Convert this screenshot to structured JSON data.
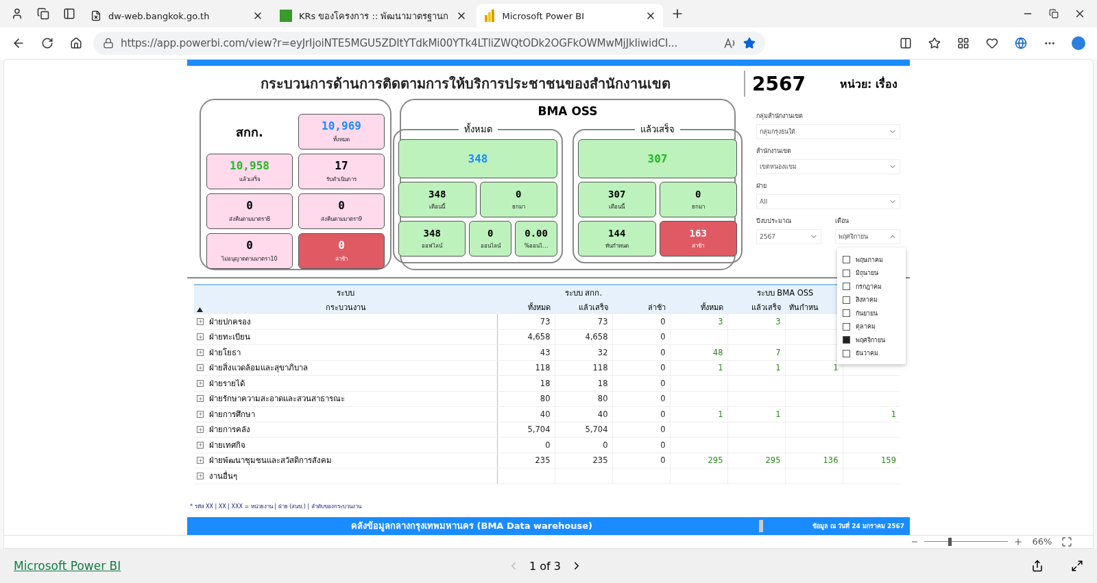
{
  "browser": {
    "tabs": [
      {
        "title": "dw-web.bangkok.go.th",
        "selected": false,
        "kind": "page"
      },
      {
        "title": "KRs ของโครงการ :: พัฒนามาตรฐานก",
        "selected": false,
        "kind": "logo"
      },
      {
        "title": "Microsoft Power BI",
        "selected": true,
        "kind": "powerbi"
      }
    ],
    "url": "https://app.powerbi.com/view?r=eyJrIjoiNTE5MGU5ZDItYTdkMi00YTk4LTliZWQtODk2OGFkOWMwMjJkIiwidCI...",
    "favorite": true
  },
  "report": {
    "title": "กระบวนการด้านการติดตามการให้บริการประชาชนของสำนักงานเขต",
    "year": "2567",
    "unit": "หน่วย: เรื่อง",
    "skk": {
      "title": "สกก.",
      "cards": [
        {
          "value": "10,969",
          "label": "ทั้งหมด",
          "late": false,
          "color": "#1a8cff"
        },
        {
          "value": "10,958",
          "label": "แล้วเสร็จ",
          "late": false,
          "color": "#22bb22"
        },
        {
          "value": "17",
          "label": "รับดำเนินการ",
          "late": false,
          "color": "#000000"
        },
        {
          "value": "0",
          "label": "ส่งคืนตามมาตรา8",
          "late": false,
          "color": "#000000"
        },
        {
          "value": "0",
          "label": "ส่งคืนตามมาตรา9",
          "late": false,
          "color": "#000000"
        },
        {
          "value": "0",
          "label": "ไม่อนุญาตตามมาตรา10",
          "late": false,
          "color": "#000000"
        },
        {
          "value": "0",
          "label": "ล่าช้า",
          "late": true,
          "color": "#ffffff"
        }
      ]
    },
    "oss": {
      "title": "BMA OSS",
      "groups": [
        {
          "title": "ทั้งหมด",
          "main": {
            "value": "348",
            "late": false,
            "color": "#1a8cff"
          },
          "rows": [
            [
              {
                "value": "348",
                "label": "เดือนนี้",
                "late": false,
                "color": "#000000"
              },
              {
                "value": "0",
                "label": "ยกมา",
                "late": false,
                "color": "#000000"
              }
            ],
            [
              {
                "value": "348",
                "label": "ออฟไลน์",
                "late": false,
                "color": "#000000"
              },
              {
                "value": "0",
                "label": "ออนไลน์",
                "late": false,
                "color": "#000000"
              },
              {
                "value": "0.00",
                "label": "%ออนไ…",
                "late": false,
                "color": "#000000"
              }
            ]
          ]
        },
        {
          "title": "แล้วเสร็จ",
          "main": {
            "value": "307",
            "late": false,
            "color": "#22bb22"
          },
          "rows": [
            [
              {
                "value": "307",
                "label": "เดือนนี้",
                "late": false,
                "color": "#000000"
              },
              {
                "value": "0",
                "label": "ยกมา",
                "late": false,
                "color": "#000000"
              }
            ],
            [
              {
                "value": "144",
                "label": "ทันกำหนด",
                "late": false,
                "color": "#000000"
              },
              {
                "value": "163",
                "label": "ล่าช้า",
                "late": true,
                "color": "#ffffff"
              }
            ]
          ]
        }
      ]
    },
    "filters": [
      {
        "label": "กลุ่มสำนักงานเขต",
        "value": "กลุ่มกรุงธนใต้",
        "open": false
      },
      {
        "label": "สำนักงานเขต",
        "value": "เขตหนองแขม",
        "open": false
      },
      {
        "label": "ฝ่าย",
        "value": "All",
        "open": false
      },
      {
        "label": "ปีงบประมาณ",
        "value": "2567",
        "open": false
      },
      {
        "label": "เดือน",
        "value": "พฤศจิกายน",
        "open": true,
        "options": [
          {
            "label": "พฤษภาคม",
            "checked": false
          },
          {
            "label": "มิถุนายน",
            "checked": false
          },
          {
            "label": "กรกฎาคม",
            "checked": false
          },
          {
            "label": "สิงหาคม",
            "checked": false
          },
          {
            "label": "กันยายน",
            "checked": false
          },
          {
            "label": "ตุลาคม",
            "checked": false
          },
          {
            "label": "พฤศจิกายน",
            "checked": true
          },
          {
            "label": "ธันวาคม",
            "checked": false
          }
        ]
      }
    ],
    "table": {
      "groups": [
        {
          "label": "ระบบ",
          "columns": [
            "กระบวนงาน"
          ]
        },
        {
          "label": "ระบบ สกก.",
          "columns": [
            "ทั้งหมด",
            "แล้วเสร็จ",
            "ล่าช้า"
          ]
        },
        {
          "label": "ระบบ BMA OSS",
          "columns": [
            "ทั้งหมด",
            "แล้วเสร็จ",
            "ทันกำหน"
          ]
        }
      ],
      "rows": [
        {
          "name": "ฝ่ายปกครอง",
          "expanded": false,
          "cells": {
            "skk_total": "73",
            "skk_done": "73",
            "skk_late": "0",
            "oss_total": "3",
            "oss_done": "3"
          }
        },
        {
          "name": "ฝ่ายทะเบียน",
          "expanded": false,
          "cells": {
            "skk_total": "4,658",
            "skk_done": "4,658",
            "skk_late": "0"
          }
        },
        {
          "name": "ฝ่ายโยธา",
          "expanded": false,
          "cells": {
            "skk_total": "43",
            "skk_done": "32",
            "skk_late": "0",
            "oss_total": "48",
            "oss_done": "7"
          }
        },
        {
          "name": "ฝ่ายสิ่งแวดล้อมและสุขาภิบาล",
          "expanded": false,
          "cells": {
            "skk_total": "118",
            "skk_done": "118",
            "skk_late": "0",
            "oss_total": "1",
            "oss_done": "1",
            "oss_on_time": "1"
          }
        },
        {
          "name": "ฝ่ายรายได้",
          "expanded": false,
          "cells": {
            "skk_total": "18",
            "skk_done": "18",
            "skk_late": "0"
          }
        },
        {
          "name": "ฝ่ายรักษาความสะอาดและสวนสาธารณะ",
          "expanded": false,
          "cells": {
            "skk_total": "80",
            "skk_done": "80",
            "skk_late": "0"
          }
        },
        {
          "name": "ฝ่ายการศึกษา",
          "expanded": false,
          "cells": {
            "skk_total": "40",
            "skk_done": "40",
            "skk_late": "0",
            "oss_total": "1",
            "oss_done": "1",
            "column_8": "1"
          }
        },
        {
          "name": "ฝ่ายการคลัง",
          "expanded": false,
          "cells": {
            "skk_total": "5,704",
            "skk_done": "5,704",
            "skk_late": "0"
          }
        },
        {
          "name": "ฝ่ายเทศกิจ",
          "expanded": false,
          "cells": {
            "skk_total": "0",
            "skk_done": "0",
            "skk_late": "0"
          }
        },
        {
          "name": "ฝ่ายพัฒนาชุมชนและสวัสดิการสังคม",
          "expanded": false,
          "cells": {
            "skk_total": "235",
            "skk_done": "235",
            "skk_late": "0",
            "oss_total": "295",
            "oss_done": "295",
            "oss_on_time": "136",
            "column_8": "159"
          }
        },
        {
          "name": "งานอื่นๆ",
          "expanded": false,
          "cells": {}
        }
      ]
    },
    "footnote": "* รหัส XX | XX | XXX = หน่วยงาน | ฝ่าย (สนข.) | ลำดับของกระบวนงาน",
    "footer": {
      "title": "คลังข้อมูลกลางกรุงเทพมหานคร (BMA Data warehouse)",
      "date": "ข้อมูล ณ วันที่  24 มกราคม 2567"
    }
  },
  "viewer": {
    "zoom": {
      "level": 0.3,
      "reading": "66%"
    },
    "page": "1 of 3",
    "brand": "Microsoft Power BI"
  }
}
